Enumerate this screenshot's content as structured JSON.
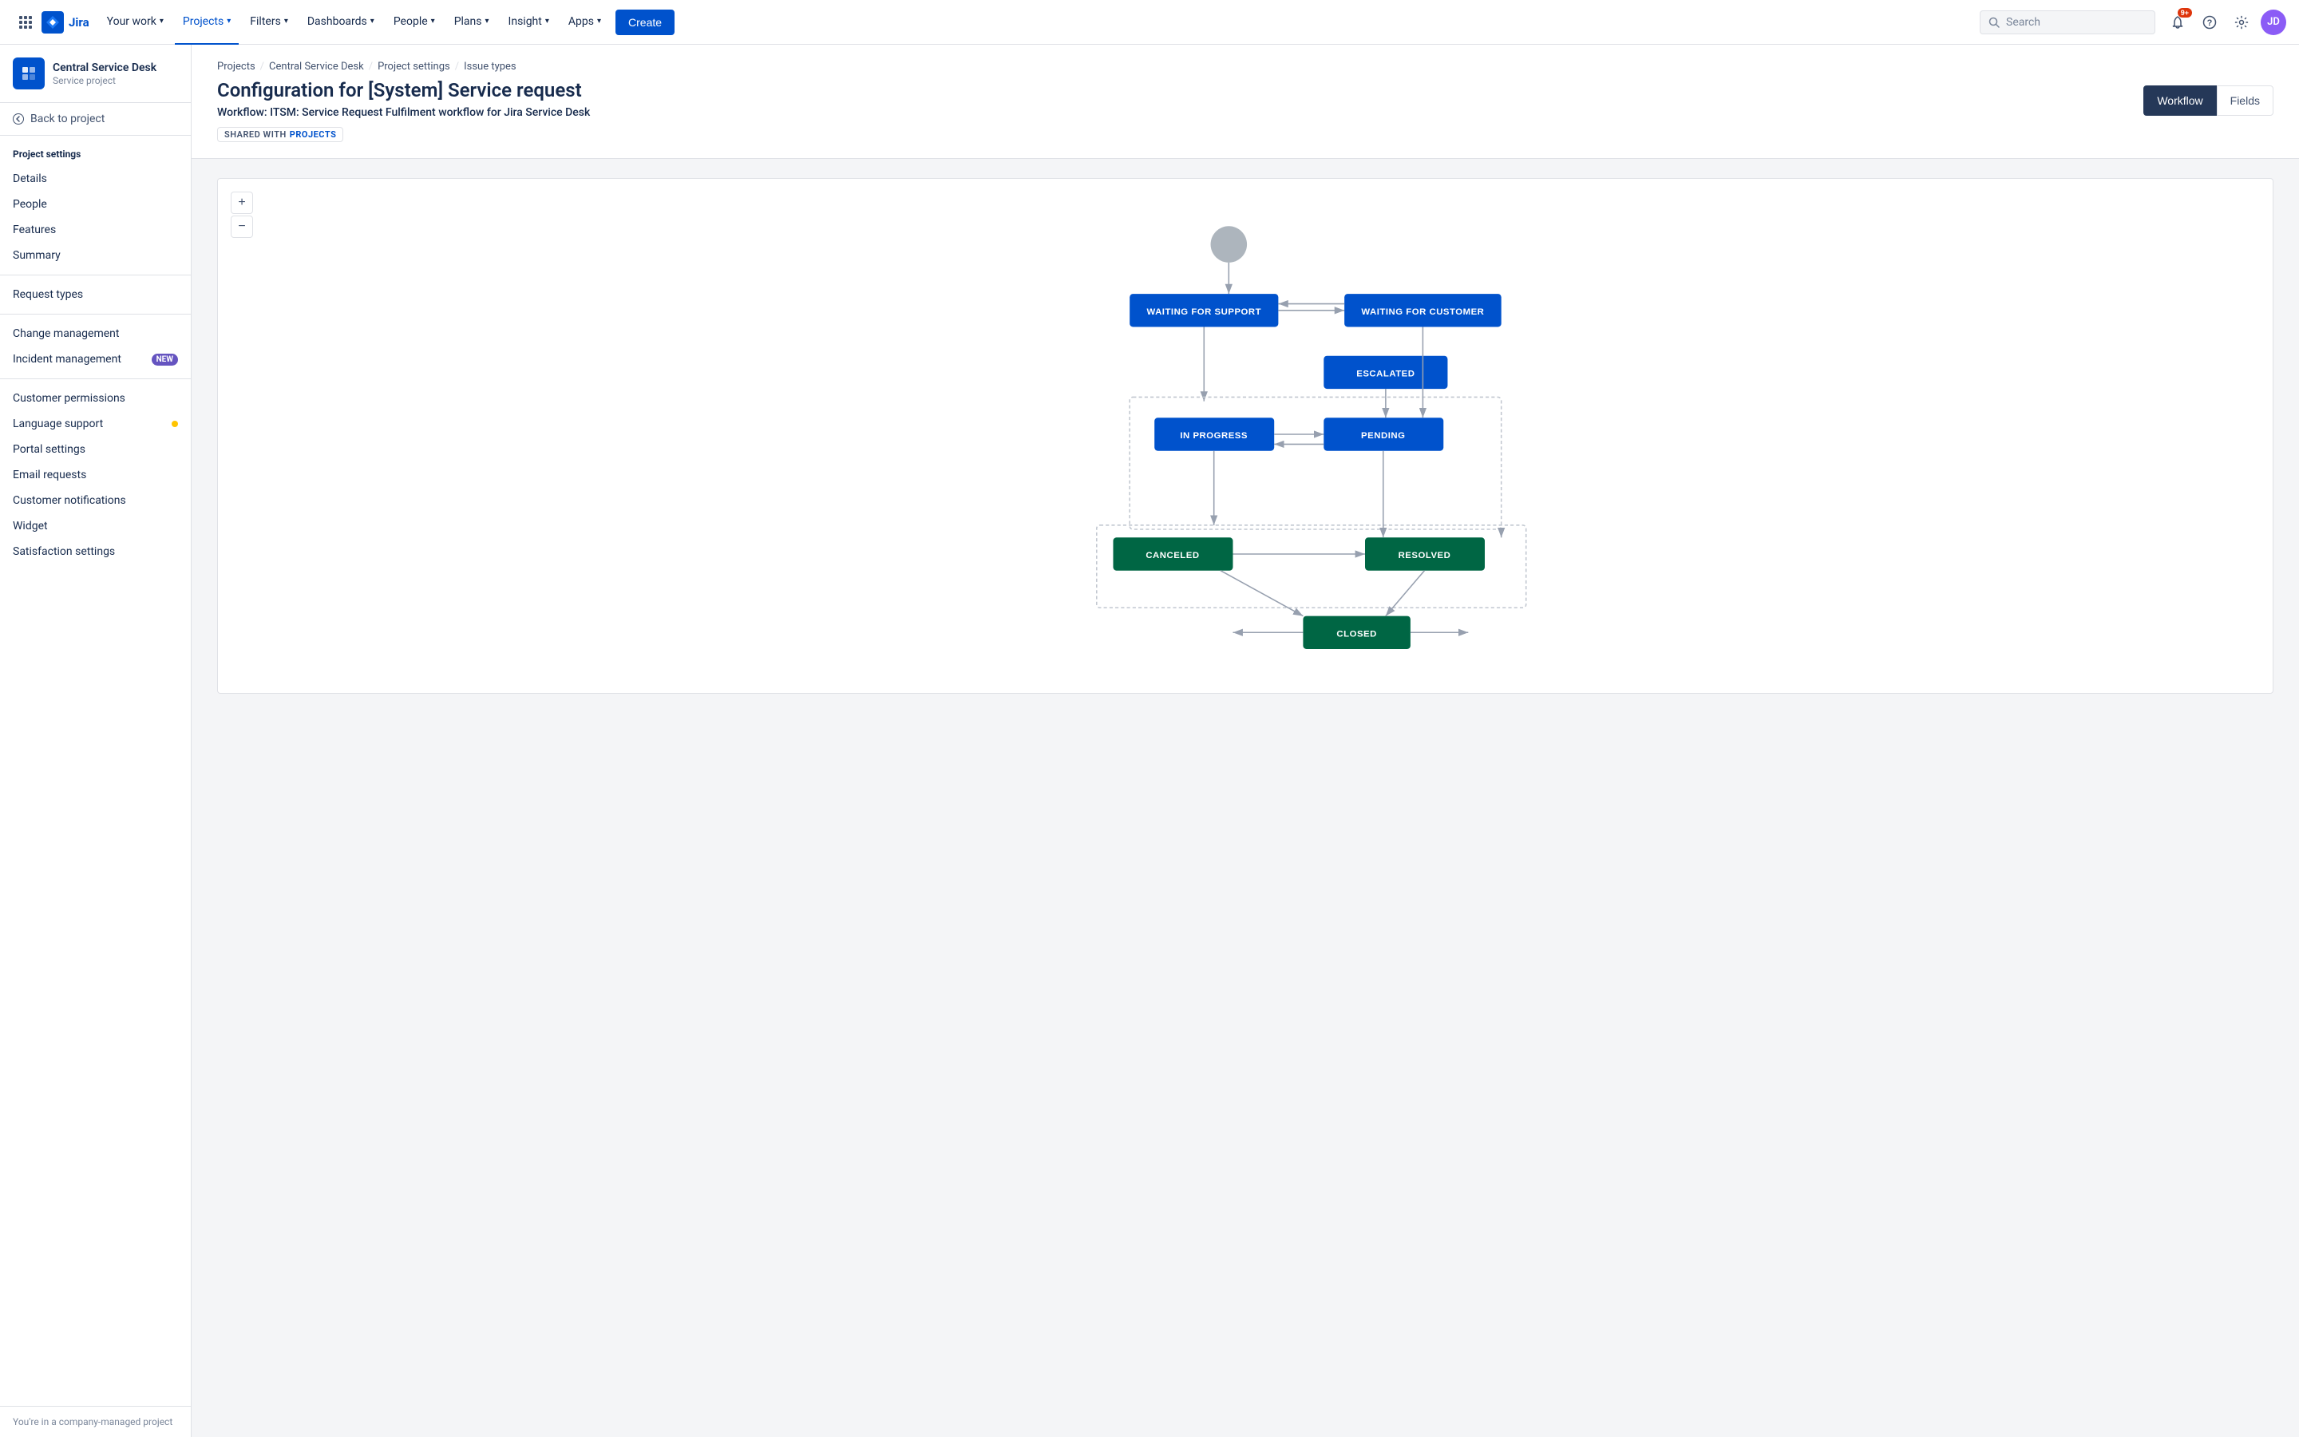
{
  "topnav": {
    "logo_text": "Jira",
    "your_work": "Your work",
    "projects": "Projects",
    "filters": "Filters",
    "dashboards": "Dashboards",
    "people": "People",
    "plans": "Plans",
    "insight": "Insight",
    "apps": "Apps",
    "create": "Create",
    "search_placeholder": "Search",
    "notification_count": "9+",
    "avatar_initials": "JD"
  },
  "sidebar": {
    "project_name": "Central Service Desk",
    "project_type": "Service project",
    "back_label": "Back to project",
    "section_title": "Project settings",
    "items": [
      {
        "label": "Details",
        "active": false
      },
      {
        "label": "People",
        "active": false
      },
      {
        "label": "Features",
        "active": false
      },
      {
        "label": "Summary",
        "active": false
      },
      {
        "label": "Request types",
        "active": false
      },
      {
        "label": "Change management",
        "active": false
      },
      {
        "label": "Incident management",
        "active": false,
        "badge": "NEW"
      },
      {
        "label": "Customer permissions",
        "active": false
      },
      {
        "label": "Language support",
        "active": false,
        "dot": true
      },
      {
        "label": "Portal settings",
        "active": false
      },
      {
        "label": "Email requests",
        "active": false
      },
      {
        "label": "Customer notifications",
        "active": false
      },
      {
        "label": "Widget",
        "active": false
      },
      {
        "label": "Satisfaction settings",
        "active": false
      }
    ],
    "footer_text": "You're in a company-managed project"
  },
  "breadcrumb": {
    "items": [
      "Projects",
      "Central Service Desk",
      "Project settings",
      "Issue types"
    ]
  },
  "header": {
    "page_title": "Configuration for [System] Service request",
    "workflow_subtitle": "Workflow: ITSM: Service Request Fulfilment workflow for Jira Service Desk",
    "shared_label": "SHARED WITH",
    "shared_link": "PROJECTS"
  },
  "tabs": {
    "workflow": "Workflow",
    "fields": "Fields"
  },
  "zoom": {
    "plus": "+",
    "minus": "−"
  },
  "workflow_nodes": {
    "waiting_for_support": "WAITING FOR SUPPORT",
    "waiting_for_customer": "WAITING FOR CUSTOMER",
    "escalated": "ESCALATED",
    "in_progress": "IN PROGRESS",
    "pending": "PENDING",
    "canceled": "CANCELED",
    "resolved": "RESOLVED",
    "closed": "CLOSED"
  },
  "colors": {
    "blue_node": "#0052cc",
    "green_node": "#006644",
    "start_circle": "#aaa",
    "arrow": "#97a0af"
  }
}
